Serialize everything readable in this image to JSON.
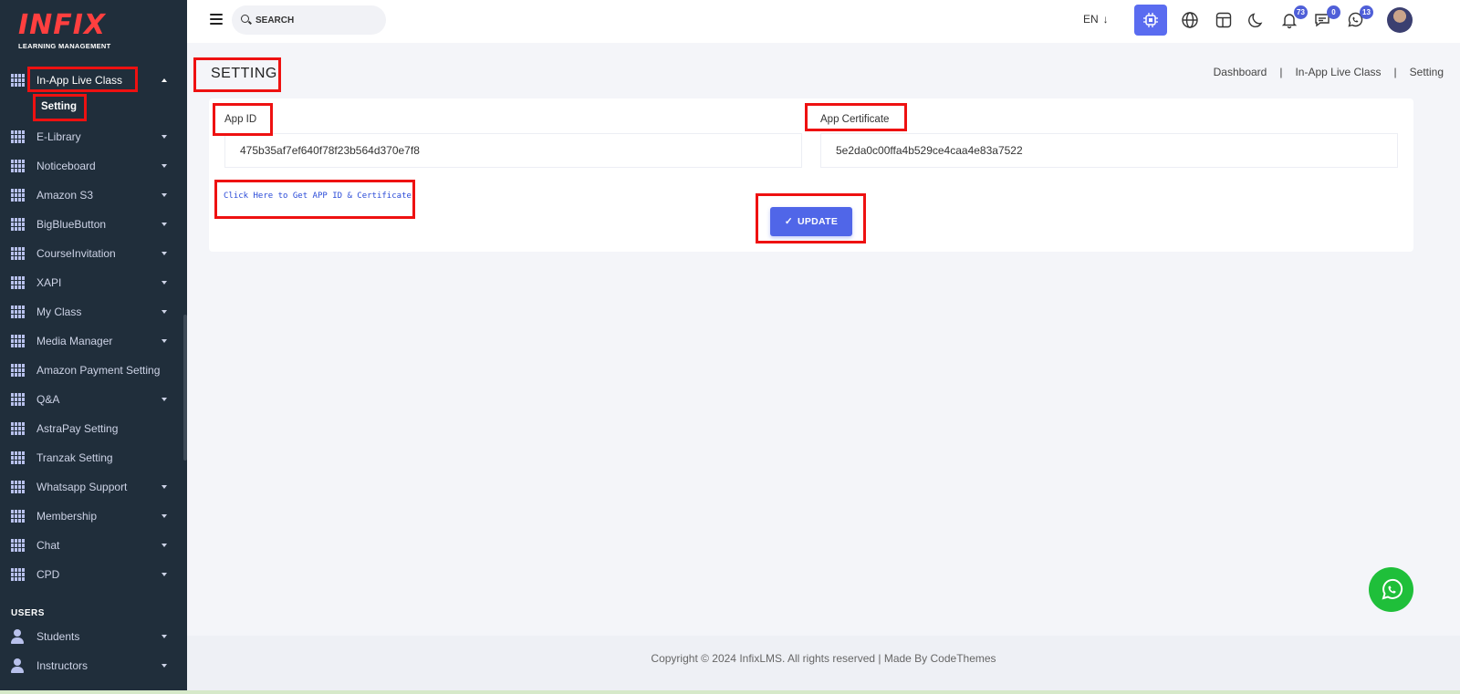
{
  "app": {
    "logo_text": "INFIX",
    "logo_subtitle": "LEARNING MANAGEMENT"
  },
  "sidebar": {
    "active_menu": {
      "label": "In-App Live Class",
      "sub_items": [
        "Setting"
      ]
    },
    "items": [
      {
        "label": "E-Library",
        "has_caret": true
      },
      {
        "label": "Noticeboard",
        "has_caret": true
      },
      {
        "label": "Amazon S3",
        "has_caret": true
      },
      {
        "label": "BigBlueButton",
        "has_caret": true
      },
      {
        "label": "CourseInvitation",
        "has_caret": true
      },
      {
        "label": "XAPI",
        "has_caret": true
      },
      {
        "label": "My Class",
        "has_caret": true
      },
      {
        "label": "Media Manager",
        "has_caret": true
      },
      {
        "label": "Amazon Payment Setting",
        "has_caret": false
      },
      {
        "label": "Q&A",
        "has_caret": true
      },
      {
        "label": "AstraPay Setting",
        "has_caret": false
      },
      {
        "label": "Tranzak Setting",
        "has_caret": false
      },
      {
        "label": "Whatsapp Support",
        "has_caret": true
      },
      {
        "label": "Membership",
        "has_caret": true
      },
      {
        "label": "Chat",
        "has_caret": true
      },
      {
        "label": "CPD",
        "has_caret": true
      }
    ],
    "users_heading": "USERS",
    "user_items": [
      {
        "label": "Students"
      },
      {
        "label": "Instructors"
      }
    ]
  },
  "topbar": {
    "search_placeholder": "SEARCH",
    "language": "EN",
    "language_arrow": "↓",
    "icons": [
      "cpu-icon",
      "globe-icon",
      "layout-icon",
      "moon-icon",
      "bell-icon",
      "message-icon",
      "whatsapp-icon"
    ],
    "badges": {
      "notifications": "73",
      "messages": "0",
      "whatsapp": "13"
    }
  },
  "page": {
    "title": "SETTING",
    "breadcrumb": [
      "Dashboard",
      "In-App Live Class",
      "Setting"
    ],
    "breadcrumb_separator": "|"
  },
  "form": {
    "app_id_label": "App ID",
    "app_id_value": "475b35af7ef640f78f23b564d370e7f8",
    "app_certificate_label": "App Certificate",
    "app_certificate_value": "5e2da0c00ffa4b529ce4caa4e83a7522",
    "get_link_text": "Click Here to Get APP ID & Certificate",
    "update_label": "UPDATE",
    "update_check": "✓"
  },
  "footer": {
    "copyright": "Copyright © 2024 InfixLMS. All rights reserved | Made By CodeThemes"
  },
  "colors": {
    "sidebar_bg": "#202e3b",
    "accent": "#5066e8",
    "highlight": "#ee1111",
    "whatsapp": "#1fbf3a"
  }
}
